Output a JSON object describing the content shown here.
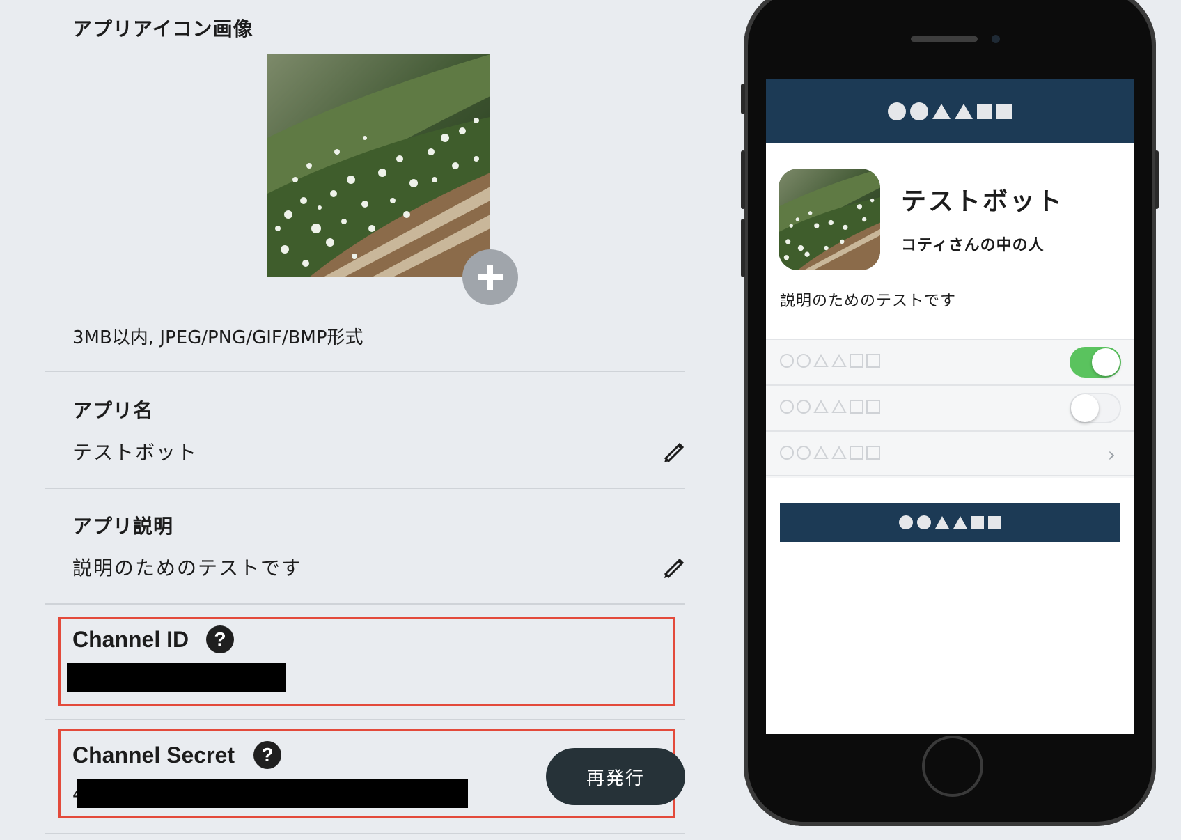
{
  "icon_section": {
    "title": "アプリアイコン画像",
    "note": "3MB以内, JPEG/PNG/GIF/BMP形式",
    "add_symbol": "+"
  },
  "app_name": {
    "title": "アプリ名",
    "value": "テストボット"
  },
  "app_description": {
    "title": "アプリ説明",
    "value": "説明のためのテストです"
  },
  "channel_id": {
    "title": "Channel ID",
    "help": "?"
  },
  "channel_secret": {
    "title": "Channel Secret",
    "help": "?",
    "partial_char": "4",
    "reissue_label": "再発行"
  },
  "preview": {
    "app_name": "テストボット",
    "provider": "コティさんの中の人",
    "description": "説明のためのテストです",
    "rows": [
      {
        "control": "toggle",
        "state": "on"
      },
      {
        "control": "toggle",
        "state": "off"
      },
      {
        "control": "chevron",
        "symbol": "›"
      }
    ]
  },
  "colors": {
    "highlight": "#e34a3b",
    "header": "#1c3a55",
    "toggle_on": "#5ac35e"
  }
}
